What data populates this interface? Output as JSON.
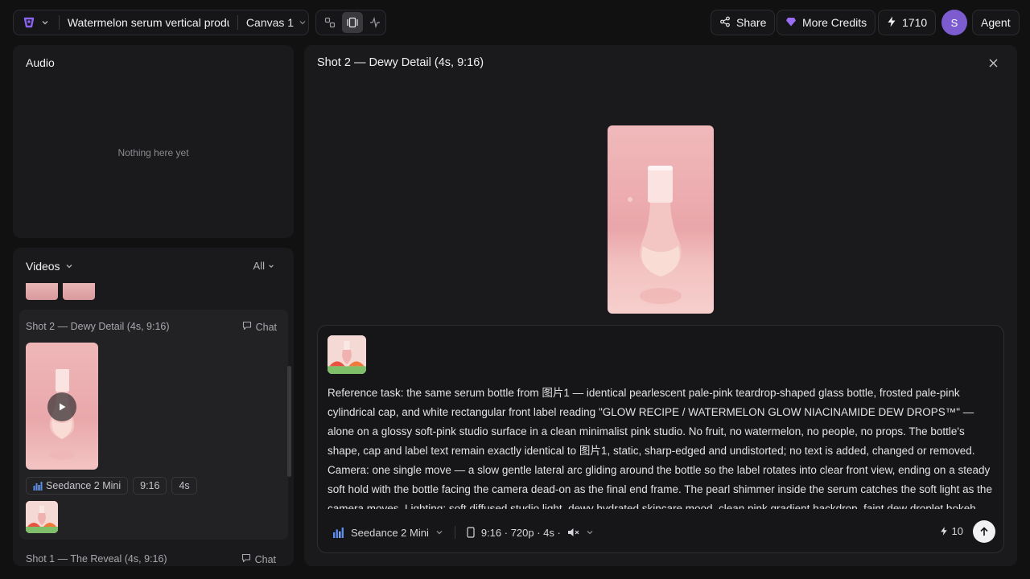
{
  "topbar": {
    "project_title": "Watermelon serum vertical produ",
    "canvas_name": "Canvas 1",
    "share_label": "Share",
    "credits_label": "More Credits",
    "credits_count": "1710",
    "avatar_initial": "S",
    "agent_label": "Agent",
    "modes": [
      "node-view-icon",
      "split-view-icon",
      "activity-icon"
    ],
    "active_mode": "split-view-icon"
  },
  "audio": {
    "title": "Audio",
    "empty_text": "Nothing here yet"
  },
  "videos": {
    "title": "Videos",
    "filter": "All",
    "shots": [
      {
        "title": "Shot 2 — Dewy Detail (4s, 9:16)",
        "chat_label": "Chat",
        "model": "Seedance 2 Mini",
        "ratio": "9:16",
        "duration": "4s"
      },
      {
        "title": "Shot 1 — The Reveal (4s, 9:16)",
        "chat_label": "Chat"
      }
    ]
  },
  "detail": {
    "title": "Shot 2 — Dewy Detail (4s, 9:16)",
    "prompt": "Reference task: the same serum bottle from 图片1 — identical pearlescent pale-pink teardrop-shaped glass bottle, frosted pale-pink cylindrical cap, and white rectangular front label reading \"GLOW RECIPE / WATERMELON GLOW NIACINAMIDE DEW DROPS™\" — alone on a glossy soft-pink studio surface in a clean minimalist pink studio. No fruit, no watermelon, no people, no props. The bottle's shape, cap and label text remain exactly identical to 图片1, static, sharp-edged and undistorted; no text is added, changed or removed. Camera: one single move — a slow gentle lateral arc gliding around the bottle so the label rotates into clear front view, ending on a steady soft hold with the bottle facing the camera dead-on as the final end frame. The pearl shimmer inside the serum catches the soft light as the camera moves. Lighting: soft diffused studio light, dewy hydrated skincare mood, clean pink gradient backdrop, faint dew droplet bokeh.",
    "model": "Seedance 2 Mini",
    "params": "9:16 · 720p · 4s ·",
    "cost": "10"
  },
  "colors": {
    "background": "#111112",
    "panel": "#1a1a1c",
    "accent_purple": "#7c5ccf",
    "preview_pink": "#eaa6aa"
  }
}
